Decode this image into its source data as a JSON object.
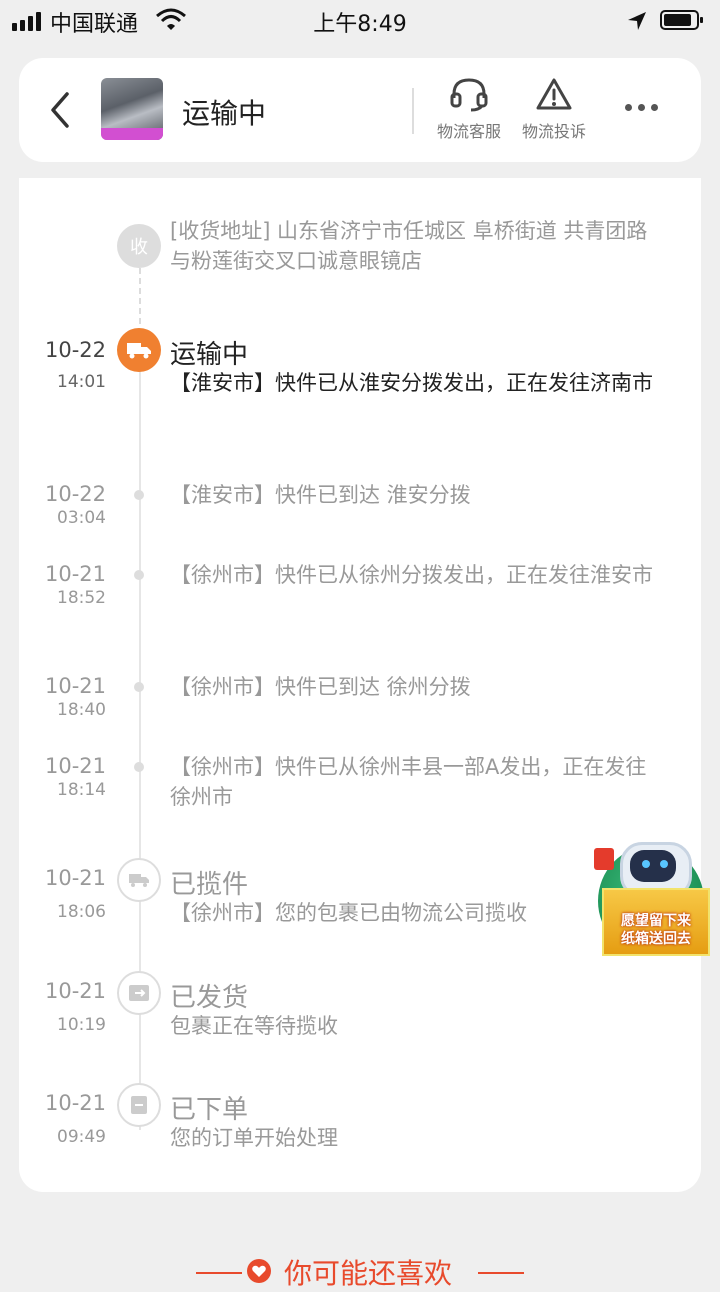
{
  "status_bar": {
    "carrier": "中国联通",
    "time": "上午8:49"
  },
  "header": {
    "title": "运输中",
    "customer_service_label": "物流客服",
    "complaint_label": "物流投诉"
  },
  "address": {
    "icon_char": "收",
    "text": "[收货地址] 山东省济宁市任城区 阜桥街道 共青团路与粉莲街交叉口诚意眼镜店"
  },
  "events": [
    {
      "date": "10-22",
      "time": "14:01",
      "status": "运输中",
      "text": "【淮安市】快件已从淮安分拨发出，正在发往济南市"
    },
    {
      "date": "10-22",
      "time": "03:04",
      "text": "【淮安市】快件已到达 淮安分拨"
    },
    {
      "date": "10-21",
      "time": "18:52",
      "text": "【徐州市】快件已从徐州分拨发出，正在发往淮安市"
    },
    {
      "date": "10-21",
      "time": "18:40",
      "text": "【徐州市】快件已到达 徐州分拨"
    },
    {
      "date": "10-21",
      "time": "18:14",
      "text": "【徐州市】快件已从徐州丰县一部A发出，正在发往徐州市"
    },
    {
      "date": "10-21",
      "time": "18:06",
      "status": "已揽件",
      "text": "【徐州市】您的包裹已由物流公司揽收"
    },
    {
      "date": "10-21",
      "time": "10:19",
      "status": "已发货",
      "text": "包裹正在等待揽收"
    },
    {
      "date": "10-21",
      "time": "09:49",
      "status": "已下单",
      "text": "您的订单开始处理"
    }
  ],
  "ad": {
    "line1": "愿望留下来",
    "line2": "纸箱送回去"
  },
  "recommend": {
    "title": "你可能还喜欢"
  },
  "colors": {
    "accent": "#f08030",
    "recommend": "#e84a2c"
  }
}
